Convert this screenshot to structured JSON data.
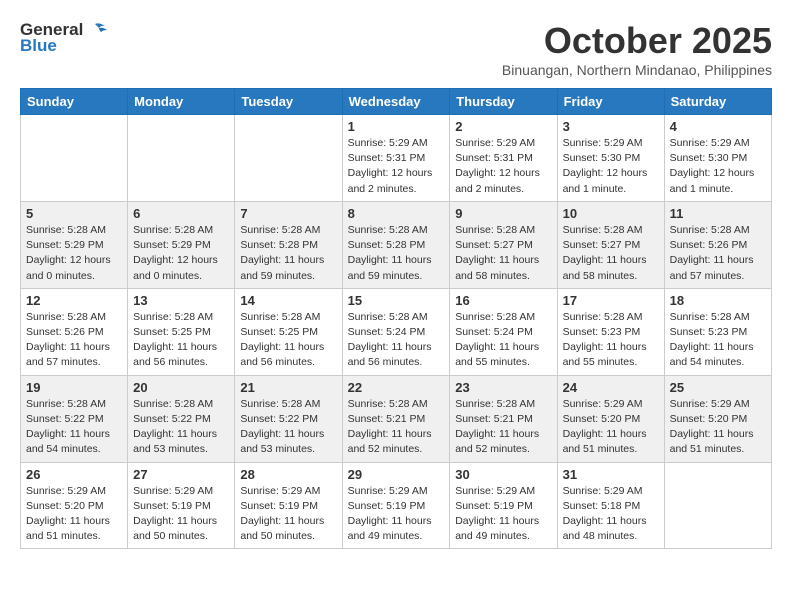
{
  "header": {
    "logo_line1": "General",
    "logo_line2": "Blue",
    "month": "October 2025",
    "location": "Binuangan, Northern Mindanao, Philippines"
  },
  "days_of_week": [
    "Sunday",
    "Monday",
    "Tuesday",
    "Wednesday",
    "Thursday",
    "Friday",
    "Saturday"
  ],
  "weeks": [
    [
      {
        "day": "",
        "info": ""
      },
      {
        "day": "",
        "info": ""
      },
      {
        "day": "",
        "info": ""
      },
      {
        "day": "1",
        "info": "Sunrise: 5:29 AM\nSunset: 5:31 PM\nDaylight: 12 hours\nand 2 minutes."
      },
      {
        "day": "2",
        "info": "Sunrise: 5:29 AM\nSunset: 5:31 PM\nDaylight: 12 hours\nand 2 minutes."
      },
      {
        "day": "3",
        "info": "Sunrise: 5:29 AM\nSunset: 5:30 PM\nDaylight: 12 hours\nand 1 minute."
      },
      {
        "day": "4",
        "info": "Sunrise: 5:29 AM\nSunset: 5:30 PM\nDaylight: 12 hours\nand 1 minute."
      }
    ],
    [
      {
        "day": "5",
        "info": "Sunrise: 5:28 AM\nSunset: 5:29 PM\nDaylight: 12 hours\nand 0 minutes."
      },
      {
        "day": "6",
        "info": "Sunrise: 5:28 AM\nSunset: 5:29 PM\nDaylight: 12 hours\nand 0 minutes."
      },
      {
        "day": "7",
        "info": "Sunrise: 5:28 AM\nSunset: 5:28 PM\nDaylight: 11 hours\nand 59 minutes."
      },
      {
        "day": "8",
        "info": "Sunrise: 5:28 AM\nSunset: 5:28 PM\nDaylight: 11 hours\nand 59 minutes."
      },
      {
        "day": "9",
        "info": "Sunrise: 5:28 AM\nSunset: 5:27 PM\nDaylight: 11 hours\nand 58 minutes."
      },
      {
        "day": "10",
        "info": "Sunrise: 5:28 AM\nSunset: 5:27 PM\nDaylight: 11 hours\nand 58 minutes."
      },
      {
        "day": "11",
        "info": "Sunrise: 5:28 AM\nSunset: 5:26 PM\nDaylight: 11 hours\nand 57 minutes."
      }
    ],
    [
      {
        "day": "12",
        "info": "Sunrise: 5:28 AM\nSunset: 5:26 PM\nDaylight: 11 hours\nand 57 minutes."
      },
      {
        "day": "13",
        "info": "Sunrise: 5:28 AM\nSunset: 5:25 PM\nDaylight: 11 hours\nand 56 minutes."
      },
      {
        "day": "14",
        "info": "Sunrise: 5:28 AM\nSunset: 5:25 PM\nDaylight: 11 hours\nand 56 minutes."
      },
      {
        "day": "15",
        "info": "Sunrise: 5:28 AM\nSunset: 5:24 PM\nDaylight: 11 hours\nand 56 minutes."
      },
      {
        "day": "16",
        "info": "Sunrise: 5:28 AM\nSunset: 5:24 PM\nDaylight: 11 hours\nand 55 minutes."
      },
      {
        "day": "17",
        "info": "Sunrise: 5:28 AM\nSunset: 5:23 PM\nDaylight: 11 hours\nand 55 minutes."
      },
      {
        "day": "18",
        "info": "Sunrise: 5:28 AM\nSunset: 5:23 PM\nDaylight: 11 hours\nand 54 minutes."
      }
    ],
    [
      {
        "day": "19",
        "info": "Sunrise: 5:28 AM\nSunset: 5:22 PM\nDaylight: 11 hours\nand 54 minutes."
      },
      {
        "day": "20",
        "info": "Sunrise: 5:28 AM\nSunset: 5:22 PM\nDaylight: 11 hours\nand 53 minutes."
      },
      {
        "day": "21",
        "info": "Sunrise: 5:28 AM\nSunset: 5:22 PM\nDaylight: 11 hours\nand 53 minutes."
      },
      {
        "day": "22",
        "info": "Sunrise: 5:28 AM\nSunset: 5:21 PM\nDaylight: 11 hours\nand 52 minutes."
      },
      {
        "day": "23",
        "info": "Sunrise: 5:28 AM\nSunset: 5:21 PM\nDaylight: 11 hours\nand 52 minutes."
      },
      {
        "day": "24",
        "info": "Sunrise: 5:29 AM\nSunset: 5:20 PM\nDaylight: 11 hours\nand 51 minutes."
      },
      {
        "day": "25",
        "info": "Sunrise: 5:29 AM\nSunset: 5:20 PM\nDaylight: 11 hours\nand 51 minutes."
      }
    ],
    [
      {
        "day": "26",
        "info": "Sunrise: 5:29 AM\nSunset: 5:20 PM\nDaylight: 11 hours\nand 51 minutes."
      },
      {
        "day": "27",
        "info": "Sunrise: 5:29 AM\nSunset: 5:19 PM\nDaylight: 11 hours\nand 50 minutes."
      },
      {
        "day": "28",
        "info": "Sunrise: 5:29 AM\nSunset: 5:19 PM\nDaylight: 11 hours\nand 50 minutes."
      },
      {
        "day": "29",
        "info": "Sunrise: 5:29 AM\nSunset: 5:19 PM\nDaylight: 11 hours\nand 49 minutes."
      },
      {
        "day": "30",
        "info": "Sunrise: 5:29 AM\nSunset: 5:19 PM\nDaylight: 11 hours\nand 49 minutes."
      },
      {
        "day": "31",
        "info": "Sunrise: 5:29 AM\nSunset: 5:18 PM\nDaylight: 11 hours\nand 48 minutes."
      },
      {
        "day": "",
        "info": ""
      }
    ]
  ]
}
